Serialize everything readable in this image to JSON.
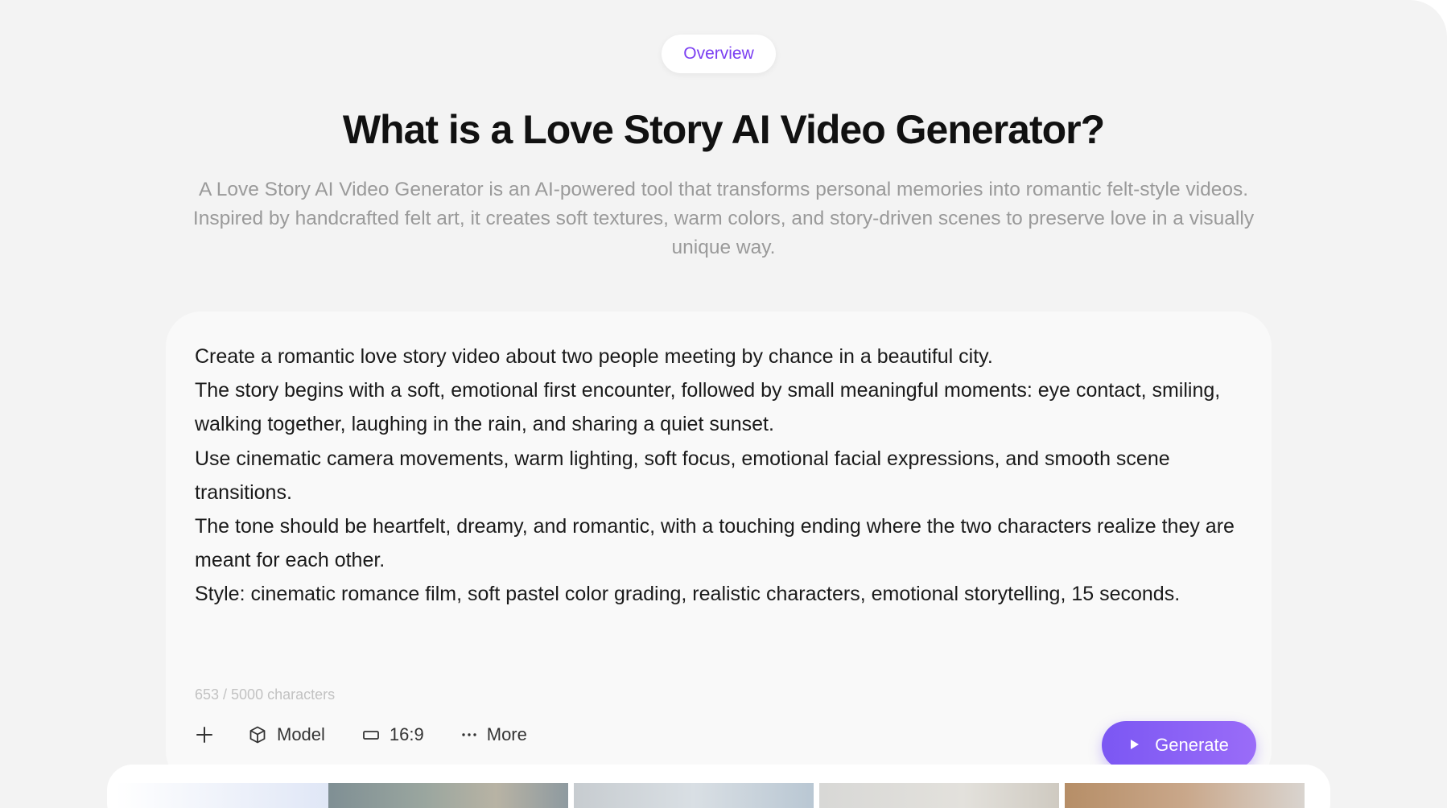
{
  "overview_label": "Overview",
  "headline": "What is a Love Story AI Video Generator?",
  "description": "A Love Story AI Video Generator is an AI-powered tool that transforms personal memories into romantic felt-style videos. Inspired by handcrafted felt art, it creates soft textures, warm colors, and story-driven scenes to preserve love in a visually unique way.",
  "prompt": {
    "lines": [
      "Create a romantic love story video about two people meeting by chance in a beautiful city.",
      "The story begins with a soft, emotional first encounter, followed by small meaningful moments: eye contact, smiling, walking together, laughing in the rain, and sharing a quiet sunset.",
      "Use cinematic camera movements, warm lighting, soft focus, emotional facial expressions, and smooth scene transitions.",
      "The tone should be heartfelt, dreamy, and romantic, with a touching ending where the two characters realize they are meant for each other.",
      "Style: cinematic romance film, soft pastel color grading, realistic characters, emotional storytelling, 15 seconds."
    ],
    "char_count": "653 / 5000 characters"
  },
  "toolbar": {
    "add_icon": "plus-icon",
    "model_icon": "cube-icon",
    "model_label": "Model",
    "ratio_icon": "aspect-ratio-icon",
    "ratio_label": "16:9",
    "more_icon": "ellipsis-icon",
    "more_label": "More",
    "generate_icon": "play-icon",
    "generate_label": "Generate"
  },
  "colors": {
    "accent": "#7b3ff2",
    "generate_start": "#7b57f3",
    "generate_end": "#9a6cf8",
    "page_bg": "#f3f3f3",
    "card_bg": "#f9f9f9"
  }
}
